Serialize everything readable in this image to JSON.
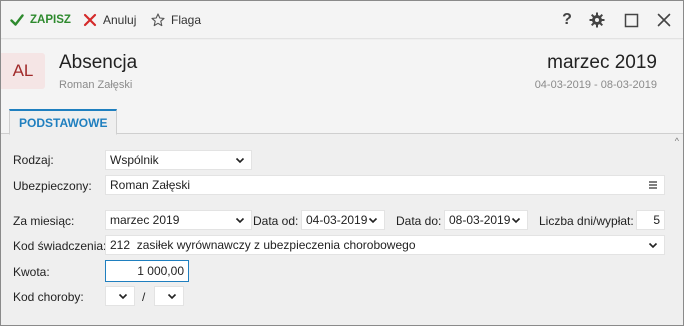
{
  "toolbar": {
    "save_label": "ZAPISZ",
    "cancel_label": "Anuluj",
    "flag_label": "Flaga",
    "help_label": "?"
  },
  "header": {
    "avatar": "AL",
    "title": "Absencja",
    "subtitle": "Roman Załęski",
    "period": "marzec 2019",
    "period_range": "04-03-2019 - 08-03-2019"
  },
  "tabs": [
    {
      "label": "PODSTAWOWE",
      "active": true
    }
  ],
  "form": {
    "rodzaj_label": "Rodzaj:",
    "rodzaj_value": "Wspólnik",
    "ubezpieczony_label": "Ubezpieczony:",
    "ubezpieczony_value": "Roman Załęski",
    "za_miesiac_label": "Za miesiąc:",
    "za_miesiac_value": "marzec 2019",
    "data_od_label": "Data od:",
    "data_od_value": "04-03-2019",
    "data_do_label": "Data do:",
    "data_do_value": "08-03-2019",
    "liczba_dni_label": "Liczba dni/wypłat:",
    "liczba_dni_value": "5",
    "kod_swiadczenia_label": "Kod świadczenia:",
    "kod_swiadczenia_value": "212  zasiłek wyrównawczy z ubezpieczenia chorobowego",
    "kwota_label": "Kwota:",
    "kwota_value": "1 000,00",
    "kod_choroby_label": "Kod choroby:",
    "kod_choroby_separator": "/"
  },
  "colors": {
    "accent": "#1f7fbf",
    "save_green": "#2e8a2e",
    "cancel_red": "#d42a2a",
    "avatar_bg": "#f5e5e5",
    "avatar_text": "#a12a2a"
  },
  "icons": [
    "check-icon",
    "x-icon",
    "star-icon",
    "help-icon",
    "gear-icon",
    "maximize-icon",
    "close-icon",
    "chevron-down-icon",
    "menu-lines-icon"
  ]
}
